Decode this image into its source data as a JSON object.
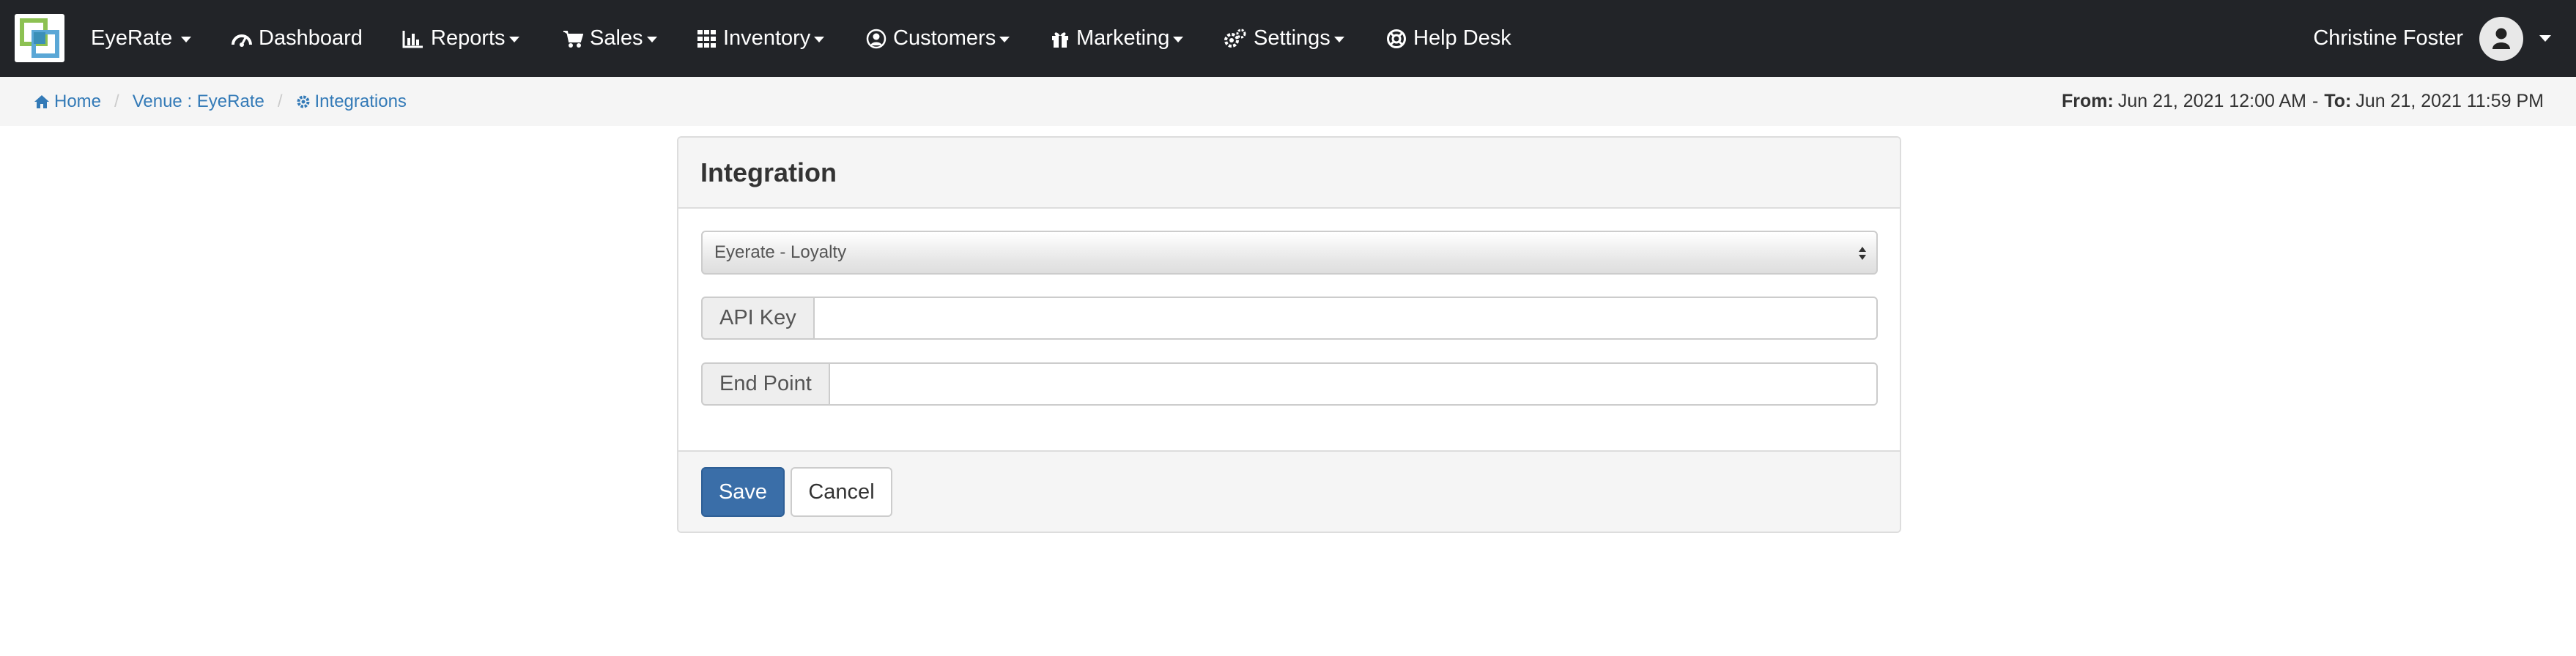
{
  "navbar": {
    "brand": "EyeRate",
    "items": [
      {
        "label": "Dashboard"
      },
      {
        "label": "Reports"
      },
      {
        "label": "Sales"
      },
      {
        "label": "Inventory"
      },
      {
        "label": "Customers"
      },
      {
        "label": "Marketing"
      },
      {
        "label": "Settings"
      },
      {
        "label": "Help Desk"
      }
    ],
    "user_name": "Christine Foster"
  },
  "breadcrumb": {
    "items": [
      {
        "label": "Home"
      },
      {
        "label": "Venue : EyeRate"
      },
      {
        "label": "Integrations"
      }
    ]
  },
  "date_range": {
    "from_label": "From:",
    "from_value": "Jun 21, 2021 12:00 AM",
    "separator": "-",
    "to_label": "To:",
    "to_value": "Jun 21, 2021 11:59 PM"
  },
  "panel": {
    "title": "Integration",
    "integration_select": {
      "selected": "Eyerate - Loyalty"
    },
    "api_key": {
      "label": "API Key",
      "value": ""
    },
    "end_point": {
      "label": "End Point",
      "value": ""
    },
    "save_label": "Save",
    "cancel_label": "Cancel"
  },
  "colors": {
    "navbar_bg": "#222428",
    "link": "#337ab7",
    "primary_button": "#3a6ea8",
    "panel_bg": "#f5f5f5"
  }
}
